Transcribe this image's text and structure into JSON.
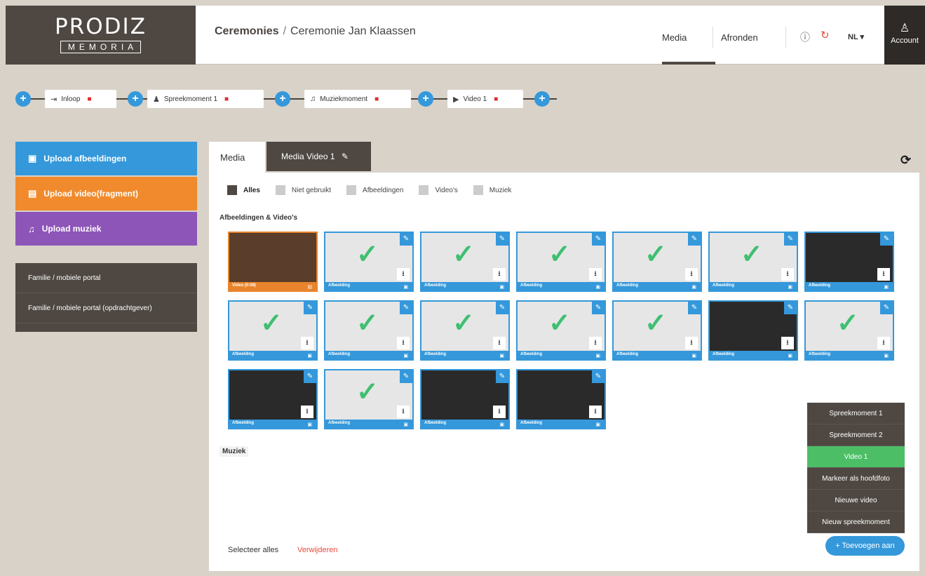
{
  "header": {
    "logo_top": "PRODIZ",
    "logo_bottom": "MEMORIA",
    "breadcrumb_root": "Ceremonies",
    "breadcrumb_sep": "/",
    "breadcrumb_current": "Ceremonie Jan Klaassen",
    "nav_media": "Media",
    "nav_afronden": "Afronden",
    "lang": "NL ▾",
    "account": "Account"
  },
  "timeline": {
    "items": [
      {
        "label": "Inloop",
        "icon": "sign-in-icon"
      },
      {
        "label": "Spreekmoment 1",
        "icon": "person-icon"
      },
      {
        "label": "Muziekmoment",
        "icon": "music-icon"
      },
      {
        "label": "Video 1",
        "icon": "video-icon"
      }
    ]
  },
  "sidebar": {
    "upload_images": "Upload afbeeldingen",
    "upload_video": "Upload video(fragment)",
    "upload_music": "Upload muziek",
    "portal_1": "Familie / mobiele portal",
    "portal_2": "Familie / mobiele portal (opdrachtgever)"
  },
  "tabs": {
    "media": "Media",
    "media_video": "Media Video 1"
  },
  "filters": [
    "Alles",
    "Niet gebruikt",
    "Afbeeldingen",
    "Video's",
    "Muziek"
  ],
  "sections": {
    "images_videos": "Afbeeldingen & Video's",
    "music": "Muziek"
  },
  "tiles": [
    {
      "caption": "Video (0:08)",
      "kind": "video",
      "used": false
    },
    {
      "caption": "Afbeelding",
      "kind": "image",
      "used": true
    },
    {
      "caption": "Afbeelding",
      "kind": "image",
      "used": true
    },
    {
      "caption": "Afbeelding",
      "kind": "image",
      "used": true
    },
    {
      "caption": "Afbeelding",
      "kind": "image",
      "used": true
    },
    {
      "caption": "Afbeelding",
      "kind": "image",
      "used": true
    },
    {
      "caption": "Afbeelding",
      "kind": "image",
      "used": false
    },
    {
      "caption": "Afbeelding",
      "kind": "image",
      "used": true
    },
    {
      "caption": "Afbeelding",
      "kind": "image",
      "used": true
    },
    {
      "caption": "Afbeelding",
      "kind": "image",
      "used": true
    },
    {
      "caption": "Afbeelding",
      "kind": "image",
      "used": true
    },
    {
      "caption": "Afbeelding",
      "kind": "image",
      "used": true
    },
    {
      "caption": "Afbeelding",
      "kind": "image",
      "used": false
    },
    {
      "caption": "Afbeelding",
      "kind": "image",
      "used": true
    },
    {
      "caption": "Afbeelding",
      "kind": "image",
      "used": false
    },
    {
      "caption": "Afbeelding",
      "kind": "image",
      "used": true
    },
    {
      "caption": "Afbeelding",
      "kind": "image",
      "used": false
    },
    {
      "caption": "Afbeelding",
      "kind": "image",
      "used": false
    }
  ],
  "context_menu": [
    {
      "label": "Spreekmoment 1",
      "active": false
    },
    {
      "label": "Spreekmoment 2",
      "active": false
    },
    {
      "label": "Video 1",
      "active": true
    },
    {
      "label": "Markeer als hoofdfoto",
      "active": false
    },
    {
      "label": "Nieuwe video",
      "active": false
    },
    {
      "label": "Nieuw spreekmoment",
      "active": false
    }
  ],
  "add_to_button": "+ Toevoegen aan",
  "footer": {
    "select_all": "Selecteer alles",
    "delete": "Verwijderen"
  },
  "colors": {
    "brand_dark": "#4f4842",
    "blue": "#3498db",
    "orange": "#f08a2c",
    "purple": "#8e55b8",
    "green": "#4cbf66",
    "red": "#e74c3c"
  }
}
